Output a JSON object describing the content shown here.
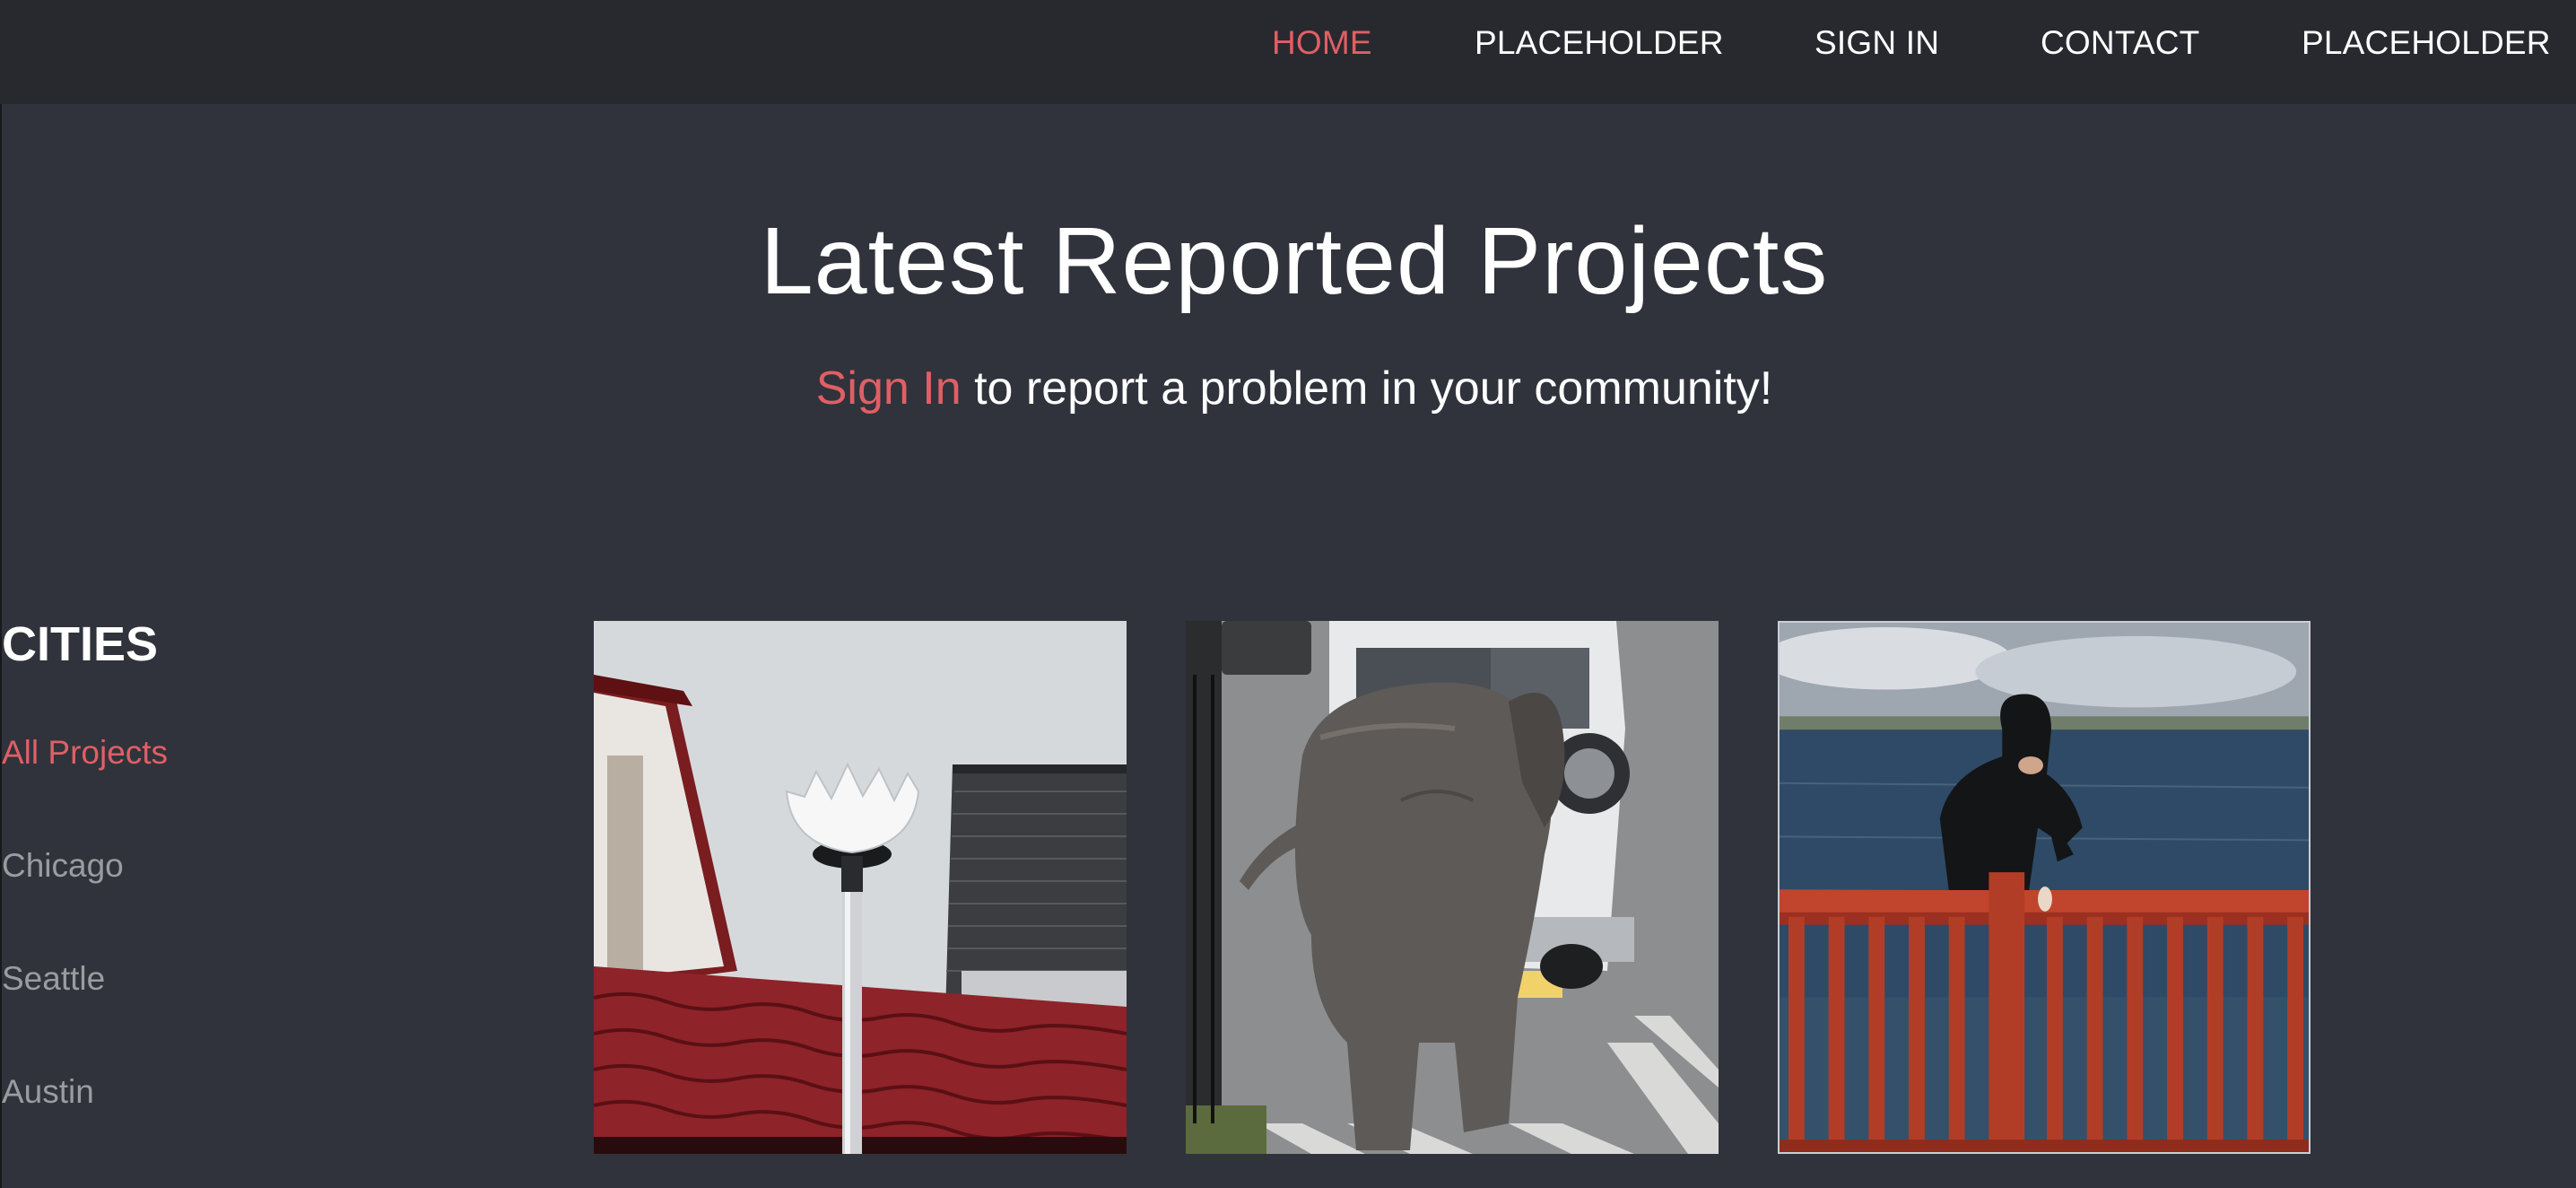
{
  "nav": {
    "items": [
      {
        "label": "HOME",
        "active": true
      },
      {
        "label": "PLACEHOLDER",
        "active": false
      },
      {
        "label": "SIGN IN",
        "active": false
      },
      {
        "label": "CONTACT",
        "active": false
      },
      {
        "label": "PLACEHOLDER",
        "active": false
      }
    ]
  },
  "hero": {
    "title": "Latest Reported Projects",
    "signin_link": "Sign In",
    "subtitle_rest": " to report a problem in your community!"
  },
  "sidebar": {
    "heading": "CITIES",
    "cities": [
      {
        "label": "All Projects",
        "active": true
      },
      {
        "label": "Chicago",
        "active": false
      },
      {
        "label": "Seattle",
        "active": false
      },
      {
        "label": "Austin",
        "active": false
      }
    ]
  },
  "projects": [
    {
      "image": "broken-street-lamp-photo"
    },
    {
      "image": "elephant-pushing-car-photo"
    },
    {
      "image": "person-on-bridge-railing-photo"
    }
  ],
  "colors": {
    "background": "#30333b",
    "topbar": "#27292e",
    "accent": "#e05f65",
    "muted_text": "#9a9ca0"
  }
}
